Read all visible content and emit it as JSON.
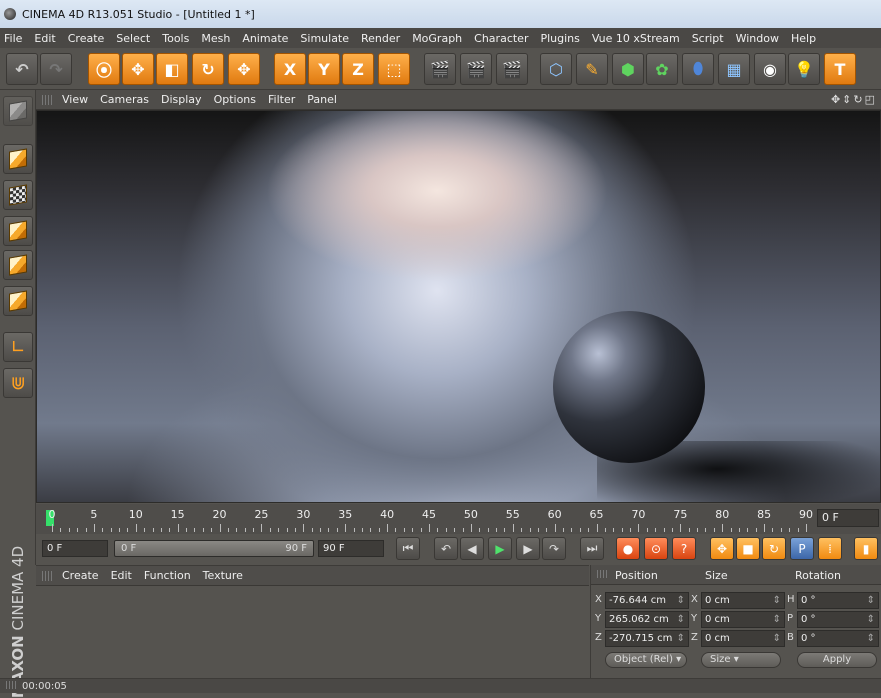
{
  "window": {
    "title": "CINEMA 4D R13.051 Studio - [Untitled 1 *]"
  },
  "menu": [
    "File",
    "Edit",
    "Create",
    "Select",
    "Tools",
    "Mesh",
    "Animate",
    "Simulate",
    "Render",
    "MoGraph",
    "Character",
    "Plugins",
    "Vue 10 xStream",
    "Script",
    "Window",
    "Help"
  ],
  "toolbar": {
    "axis_x": "X",
    "axis_y": "Y",
    "axis_z": "Z"
  },
  "viewport": {
    "menu": [
      "View",
      "Cameras",
      "Display",
      "Options",
      "Filter",
      "Panel"
    ]
  },
  "timeline": {
    "ticks": [
      "0",
      "5",
      "10",
      "15",
      "20",
      "25",
      "30",
      "35",
      "40",
      "45",
      "50",
      "55",
      "60",
      "65",
      "70",
      "75",
      "80",
      "85",
      "90"
    ],
    "current_frame": "0 F"
  },
  "transport": {
    "start": "0 F",
    "range_start": "0 F",
    "range_end": "90 F",
    "end": "90 F"
  },
  "materials": {
    "menu": [
      "Create",
      "Edit",
      "Function",
      "Texture"
    ]
  },
  "coordinates": {
    "headers": {
      "position": "Position",
      "size": "Size",
      "rotation": "Rotation"
    },
    "rows": [
      {
        "axis": "X",
        "pos": "-76.644 cm",
        "size_axis": "X",
        "size": "0 cm",
        "rot_axis": "H",
        "rot": "0 °"
      },
      {
        "axis": "Y",
        "pos": "265.062 cm",
        "size_axis": "Y",
        "size": "0 cm",
        "rot_axis": "P",
        "rot": "0 °"
      },
      {
        "axis": "Z",
        "pos": "-270.715 cm",
        "size_axis": "Z",
        "size": "0 cm",
        "rot_axis": "B",
        "rot": "0 °"
      }
    ],
    "mode": "Object (Rel)",
    "size_mode": "Size",
    "apply": "Apply"
  },
  "brand": {
    "maxon": "MAXON",
    "product": "CINEMA 4D"
  },
  "status": {
    "time": "00:00:05"
  }
}
